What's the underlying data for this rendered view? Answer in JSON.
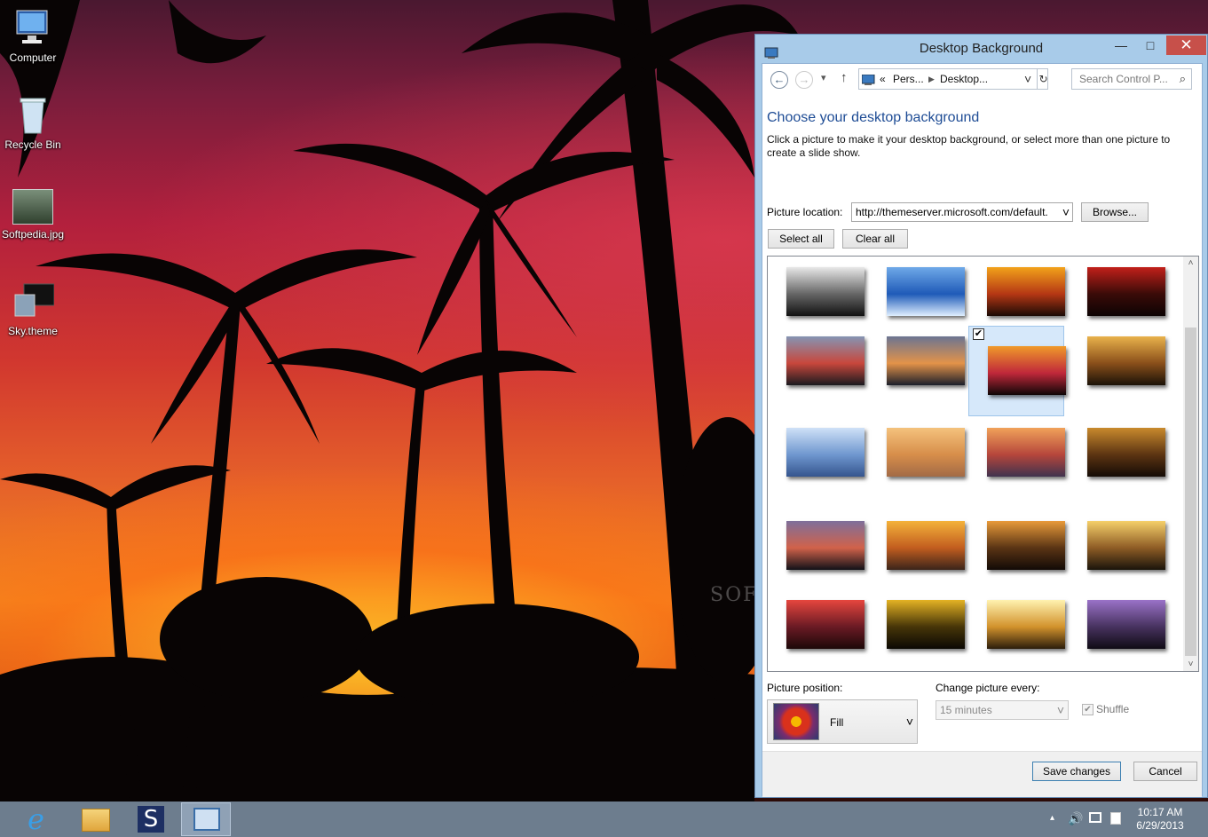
{
  "desktop": {
    "icons": [
      {
        "label": "Computer",
        "icon": "computer-icon"
      },
      {
        "label": "Recycle Bin",
        "icon": "recycle-bin-icon"
      },
      {
        "label": "Softpedia.jpg",
        "icon": "image-file-icon"
      },
      {
        "label": "Sky.theme",
        "icon": "theme-file-icon"
      }
    ],
    "watermark": "SOFTPEDIA"
  },
  "window": {
    "title": "Desktop Background",
    "controls": {
      "minimize": "—",
      "maximize": "□",
      "close": "✕"
    },
    "nav": {
      "back": "←",
      "forward": "→",
      "recent": "▾",
      "up": "↑",
      "breadcrumb_chevron": "«",
      "breadcrumb": [
        "Pers...",
        "Desktop..."
      ],
      "dropdown": "˅",
      "refresh": "↻",
      "search_placeholder": "Search Control P...",
      "search_icon": "⌕"
    },
    "heading": "Choose your desktop background",
    "description": "Click a picture to make it your desktop background, or select more than one picture to create a slide show.",
    "picture_location_label": "Picture location:",
    "picture_location_value": "http://themeserver.microsoft.com/default.",
    "select_arrow": "˅",
    "browse_label": "Browse...",
    "select_all_label": "Select all",
    "clear_all_label": "Clear all",
    "checked_mark": "✔",
    "thumbnails": [
      {
        "colors": [
          "#e8e8e8",
          "#666666",
          "#111111"
        ],
        "selected": false
      },
      {
        "colors": [
          "#6fa9e8",
          "#1f5ab8",
          "#dfefff"
        ],
        "selected": false
      },
      {
        "colors": [
          "#f2a21a",
          "#b53714",
          "#1b0a05"
        ],
        "selected": false
      },
      {
        "colors": [
          "#c2201a",
          "#3a0b08",
          "#0c0303"
        ],
        "selected": false
      },
      {
        "colors": [
          "#8594b3",
          "#c8473c",
          "#1a1a1f"
        ],
        "selected": false
      },
      {
        "colors": [
          "#6b7492",
          "#e39349",
          "#1c1f2b"
        ],
        "selected": false
      },
      {
        "colors": [
          "#f09a2a",
          "#c0283a",
          "#0e0606"
        ],
        "selected": true
      },
      {
        "colors": [
          "#e9b24b",
          "#8a4f1a",
          "#1b1208"
        ],
        "selected": false
      },
      {
        "colors": [
          "#cfe1f7",
          "#6f97cf",
          "#35558e"
        ],
        "selected": false
      },
      {
        "colors": [
          "#f4c27d",
          "#d78e4a",
          "#a26a46"
        ],
        "selected": false
      },
      {
        "colors": [
          "#f1a25a",
          "#b6463b",
          "#40324e"
        ],
        "selected": false
      },
      {
        "colors": [
          "#c98a2d",
          "#5c3412",
          "#140b05"
        ],
        "selected": false
      },
      {
        "colors": [
          "#7e6f9a",
          "#d1624a",
          "#111118"
        ],
        "selected": false
      },
      {
        "colors": [
          "#f4b23a",
          "#c25d1f",
          "#3b241a"
        ],
        "selected": false
      },
      {
        "colors": [
          "#e89a3a",
          "#5a3414",
          "#120a06"
        ],
        "selected": false
      },
      {
        "colors": [
          "#f5d06a",
          "#8e5c25",
          "#1a140b"
        ],
        "selected": false
      },
      {
        "colors": [
          "#e6463e",
          "#6a1a24",
          "#1c0808"
        ],
        "selected": false
      },
      {
        "colors": [
          "#e4b224",
          "#463508",
          "#0b0803"
        ],
        "selected": false
      },
      {
        "colors": [
          "#fff2b0",
          "#d2922c",
          "#2b1d0b"
        ],
        "selected": false
      },
      {
        "colors": [
          "#9a72c8",
          "#47325f",
          "#0f0b14"
        ],
        "selected": false
      }
    ],
    "scroll_up": "˄",
    "scroll_down": "˅",
    "picture_position_label": "Picture position:",
    "picture_position_value": "Fill",
    "change_every_label": "Change picture every:",
    "change_every_value": "15 minutes",
    "shuffle_label": "Shuffle",
    "save_label": "Save changes",
    "cancel_label": "Cancel"
  },
  "taskbar": {
    "pinned": [
      {
        "name": "internet-explorer-icon",
        "letter": "e"
      },
      {
        "name": "file-explorer-icon",
        "letter": ""
      },
      {
        "name": "softpedia-s-icon",
        "letter": "S"
      },
      {
        "name": "control-panel-icon",
        "letter": ""
      }
    ],
    "tray": {
      "show_hidden": "▴",
      "time": "10:17 AM",
      "date": "6/29/2013"
    }
  }
}
